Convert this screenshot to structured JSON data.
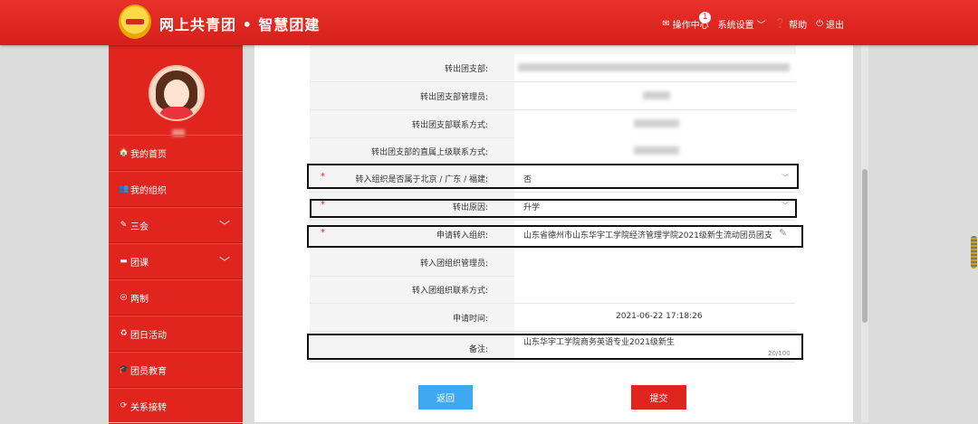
{
  "header": {
    "brand": "网上共青团 • 智慧团建",
    "nav": {
      "ops_center": "操作中心",
      "ops_badge": "1",
      "settings": "系统设置",
      "help": "帮助",
      "logout": "退出"
    }
  },
  "sidebar": {
    "items": [
      {
        "label": "我的首页",
        "icon": "home-icon"
      },
      {
        "label": "我的组织",
        "icon": "users-icon"
      },
      {
        "label": "三会",
        "icon": "edit-icon"
      },
      {
        "label": "团课",
        "icon": "folder-icon"
      },
      {
        "label": "两制",
        "icon": "target-icon"
      },
      {
        "label": "团日活动",
        "icon": "recycle-icon"
      },
      {
        "label": "团员教育",
        "icon": "graduation-cap-icon"
      },
      {
        "label": "关系接转",
        "icon": "refresh-icon"
      }
    ]
  },
  "form": {
    "fields": {
      "out_branch": {
        "label": "转出团支部:"
      },
      "out_admin": {
        "label": "转出团支部管理员:"
      },
      "out_contact": {
        "label": "转出团支部联系方式:"
      },
      "out_parent_contact": {
        "label": "转出团支部的直属上级联系方式:"
      },
      "is_bj_gd_fj": {
        "label": "转入组织是否属于北京 / 广东 / 福建:",
        "value": "否",
        "required": "*"
      },
      "reason": {
        "label": "转出原因:",
        "value": "升学",
        "required": "*"
      },
      "target_org": {
        "label": "申请转入组织:",
        "value": "山东省德州市山东华宇工学院经济管理学院2021级新生流动团员团支",
        "required": "*"
      },
      "in_admin": {
        "label": "转入团组织管理员:"
      },
      "in_contact": {
        "label": "转入团组织联系方式:"
      },
      "apply_time": {
        "label": "申请时间:",
        "value": "2021-06-22 17:18:26"
      },
      "remark": {
        "label": "备注:",
        "value": "山东华宇工学院商务英语专业2021级新生",
        "counter": "20/100"
      }
    },
    "buttons": {
      "back": "返回",
      "submit": "提交"
    }
  }
}
